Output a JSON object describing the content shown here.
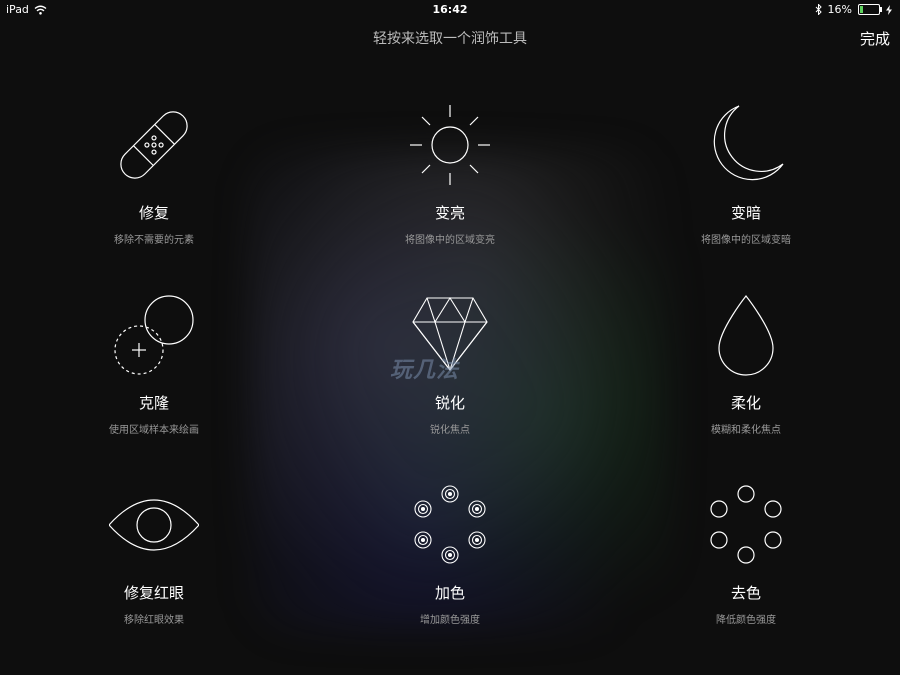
{
  "status": {
    "device": "iPad",
    "time": "16:42",
    "battery": "16%",
    "battery_level": 0.16
  },
  "header": {
    "title": "轻按来选取一个润饰工具",
    "done_label": "完成"
  },
  "watermark": "玩几法",
  "tools": [
    {
      "icon": "bandage-icon",
      "name": "修复",
      "desc": "移除不需要的元素"
    },
    {
      "icon": "sun-icon",
      "name": "变亮",
      "desc": "将图像中的区域变亮"
    },
    {
      "icon": "moon-icon",
      "name": "变暗",
      "desc": "将图像中的区域变暗"
    },
    {
      "icon": "clone-circles-icon",
      "name": "克隆",
      "desc": "使用区域样本来绘画"
    },
    {
      "icon": "diamond-icon",
      "name": "锐化",
      "desc": "锐化焦点"
    },
    {
      "icon": "drop-icon",
      "name": "柔化",
      "desc": "模糊和柔化焦点"
    },
    {
      "icon": "eye-icon",
      "name": "修复红眼",
      "desc": "移除红眼效果"
    },
    {
      "icon": "saturate-dots-icon",
      "name": "加色",
      "desc": "增加颜色强度"
    },
    {
      "icon": "desaturate-dots-icon",
      "name": "去色",
      "desc": "降低颜色强度"
    }
  ]
}
